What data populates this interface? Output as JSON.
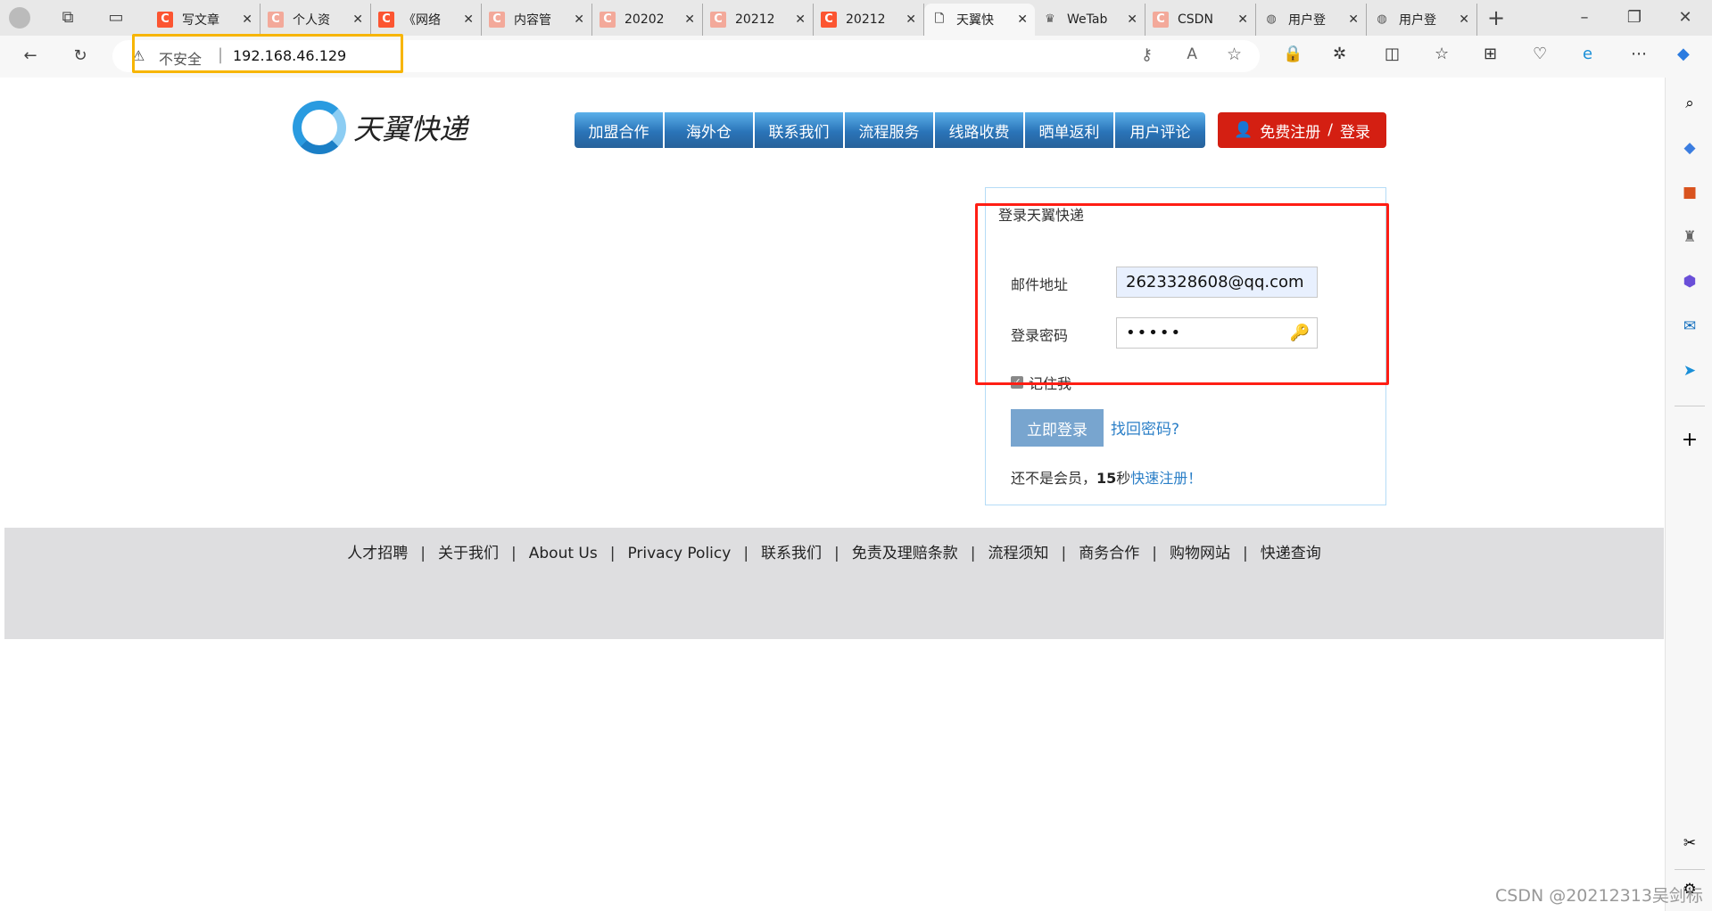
{
  "browser": {
    "tabs": [
      {
        "title": "写文章",
        "favicon": "csdn-icon",
        "color": "#fc5531"
      },
      {
        "title": "个人资",
        "favicon": "csdn-icon",
        "color": "#f3a99a"
      },
      {
        "title": "《网络",
        "favicon": "csdn-icon",
        "color": "#fc5531"
      },
      {
        "title": "内容管",
        "favicon": "csdn-icon",
        "color": "#f3a99a"
      },
      {
        "title": "20202",
        "favicon": "csdn-icon",
        "color": "#f3a99a"
      },
      {
        "title": "20212",
        "favicon": "csdn-icon",
        "color": "#f3a99a"
      },
      {
        "title": "20212",
        "favicon": "csdn-icon",
        "color": "#fc5531"
      },
      {
        "title": "天翼快",
        "favicon": "page-icon",
        "color": "#ffffff",
        "active": true
      },
      {
        "title": "WeTab",
        "favicon": "wetab-icon",
        "color": "#ffffff"
      },
      {
        "title": "CSDN",
        "favicon": "csdn-icon",
        "color": "#f3a99a"
      },
      {
        "title": "用户登",
        "favicon": "globe-icon",
        "color": "#ffffff"
      },
      {
        "title": "用户登",
        "favicon": "globe-icon",
        "color": "#ffffff"
      }
    ],
    "security_label": "不安全",
    "url": "192.168.46.129"
  },
  "site": {
    "logo_text": "天翼快递",
    "nav": [
      "加盟合作",
      "海外仓",
      "联系我们",
      "流程服务",
      "线路收费",
      "晒单返利",
      "用户评论"
    ],
    "register_label": "免费注册",
    "slash": "/",
    "login_label": "登录"
  },
  "login": {
    "title": "登录天翼快递",
    "email_label": "邮件地址",
    "email_value": "2623328608@qq.com",
    "password_label": "登录密码",
    "password_mask": "•••••",
    "remember_label": "记住我",
    "remember_checked": true,
    "submit_label": "立即登录",
    "forgot_label": "找回密码?",
    "join_prefix": "还不是会员，",
    "join_bold": "15",
    "join_mid": "秒",
    "join_link": "快速注册！"
  },
  "footer": {
    "links": [
      "人才招聘",
      "关于我们",
      "About Us",
      "Privacy Policy",
      "联系我们",
      "免责及理赔条款",
      "流程须知",
      "商务合作",
      "购物网站",
      "快递查询"
    ]
  },
  "watermark": "CSDN @20212313吴剑标"
}
